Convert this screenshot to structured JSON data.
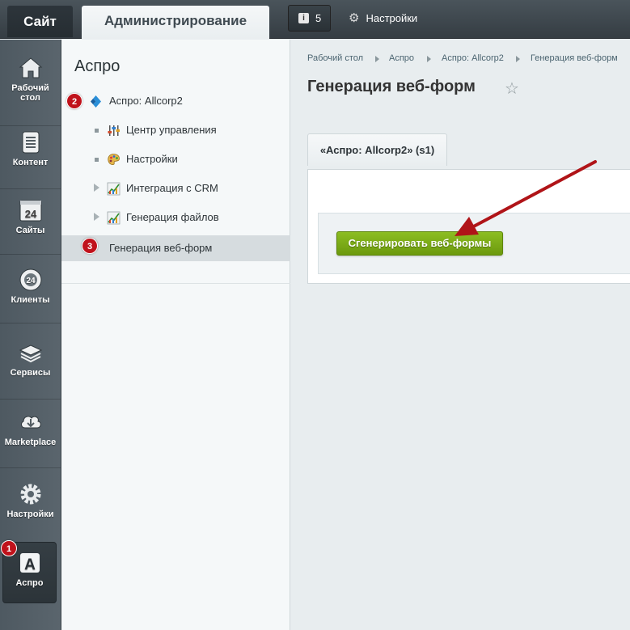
{
  "topbar": {
    "site_tab": "Сайт",
    "admin_tab": "Администрирование",
    "notifications_count": "5",
    "settings_label": "Настройки"
  },
  "leftmenu": {
    "items": [
      {
        "label": "Рабочий стол",
        "icon": "home-icon"
      },
      {
        "label": "Контент",
        "icon": "document-icon"
      },
      {
        "label": "Сайты",
        "icon": "calendar-24-icon"
      },
      {
        "label": "Клиенты",
        "icon": "clients-24-icon"
      },
      {
        "label": "Сервисы",
        "icon": "layers-icon"
      },
      {
        "label": "Marketplace",
        "icon": "cloud-download-icon"
      },
      {
        "label": "Настройки",
        "icon": "gear-icon"
      },
      {
        "label": "Аспро",
        "icon": "aspro-a-icon"
      }
    ],
    "active_badge": "1"
  },
  "panel": {
    "title": "Аспро",
    "items": [
      {
        "label": "Аспро: Allcorp2",
        "badge": "2"
      },
      {
        "label": "Центр управления"
      },
      {
        "label": "Настройки"
      },
      {
        "label": "Интеграция с CRM"
      },
      {
        "label": "Генерация файлов"
      },
      {
        "label": "Генерация веб-форм",
        "badge": "3"
      }
    ]
  },
  "breadcrumb": [
    "Рабочий стол",
    "Аспро",
    "Аспро: Allcorp2",
    "Генерация веб-форм"
  ],
  "main": {
    "title": "Генерация веб-форм",
    "tab_label": "«Аспро: Allcorp2» (s1)",
    "generate_button": "Сгенерировать веб-формы"
  },
  "colors": {
    "accent_green": "#7aab16",
    "badge_red": "#c0121b",
    "arrow_red": "#b01418"
  }
}
